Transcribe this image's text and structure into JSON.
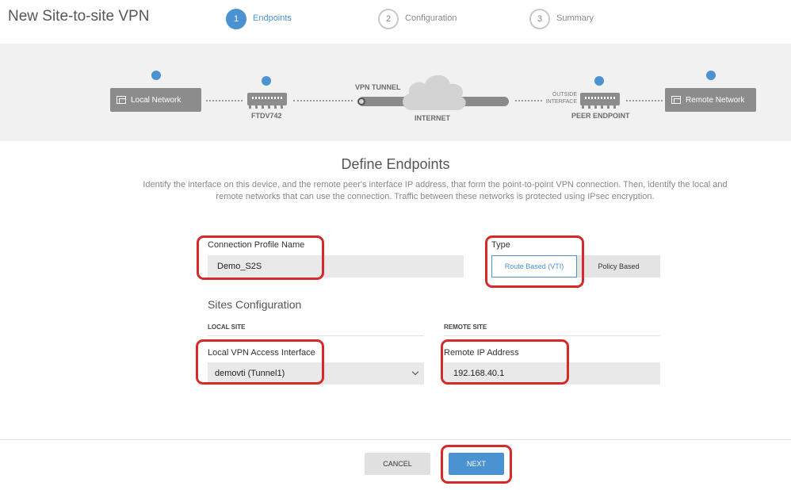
{
  "page_title": "New Site-to-site VPN",
  "steps": [
    {
      "number": "1",
      "label": "Endpoints"
    },
    {
      "number": "2",
      "label": "Configuration"
    },
    {
      "number": "3",
      "label": "Summary"
    }
  ],
  "topology": {
    "local_network": "Local Network",
    "local_device": "FTDV742",
    "tunnel": "VPN TUNNEL",
    "internet": "INTERNET",
    "outside_interface_line1": "OUTSIDE",
    "outside_interface_line2": "INTERFACE",
    "peer_endpoint": "PEER ENDPOINT",
    "remote_network": "Remote Network"
  },
  "section": {
    "title": "Define Endpoints",
    "description": "Identify the interface on this device, and the remote peer's interface IP address, that form the point-to-point VPN connection. Then, identify the local and remote networks that can use the connection. Traffic between these networks is protected using IPsec encryption."
  },
  "connection_profile": {
    "label": "Connection Profile Name",
    "value": "Demo_S2S"
  },
  "type": {
    "label": "Type",
    "options": [
      "Route Based (VTI)",
      "Policy Based"
    ],
    "selected": "Route Based (VTI)"
  },
  "sites": {
    "heading": "Sites Configuration",
    "local_heading": "LOCAL SITE",
    "remote_heading": "REMOTE SITE",
    "local_interface_label": "Local VPN Access Interface",
    "local_interface_value": "demovti (Tunnel1)",
    "remote_ip_label": "Remote IP Address",
    "remote_ip_value": "192.168.40.1"
  },
  "footer": {
    "cancel_label": "CANCEL",
    "next_label": "NEXT"
  },
  "colors": {
    "accent": "#4b92d2",
    "highlight": "#d62a2a"
  }
}
